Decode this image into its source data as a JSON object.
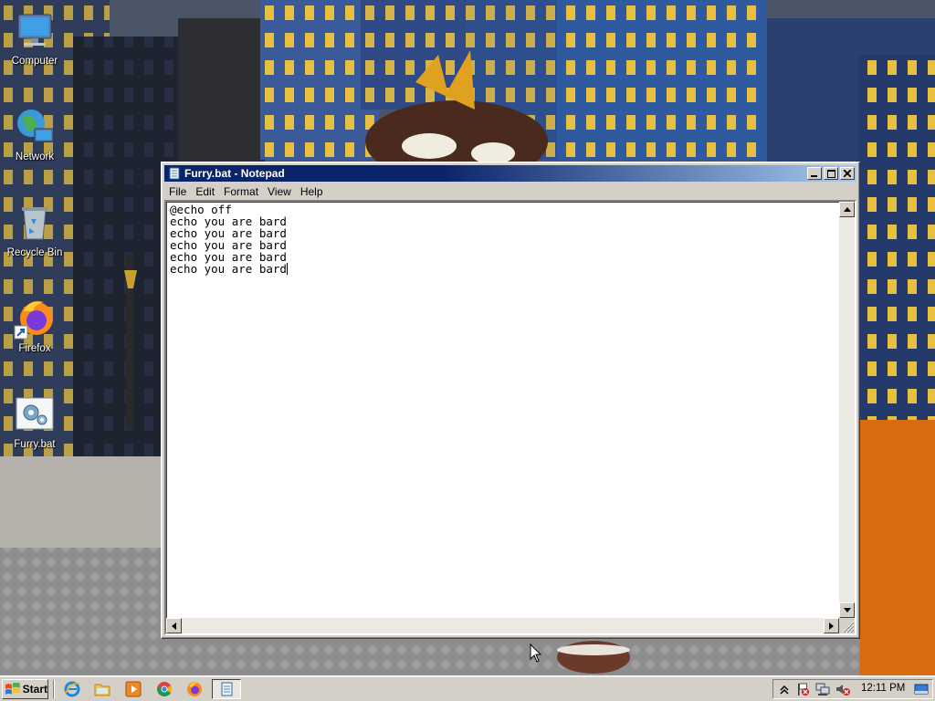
{
  "desktop": {
    "icons": [
      {
        "label": "Computer",
        "icon": "computer-icon"
      },
      {
        "label": "Network",
        "icon": "network-icon"
      },
      {
        "label": "Recycle Bin",
        "icon": "recycle-bin-icon"
      },
      {
        "label": "Firefox",
        "icon": "firefox-icon"
      },
      {
        "label": "Furry.bat",
        "icon": "batch-file-icon"
      }
    ]
  },
  "notepad": {
    "title": "Furry.bat - Notepad",
    "menu": [
      "File",
      "Edit",
      "Format",
      "View",
      "Help"
    ],
    "content": "@echo off\necho you are bard\necho you are bard\necho you are bard\necho you are bard\necho you are bard",
    "buttons": {
      "minimize": "minimize-icon",
      "maximize": "maximize-icon",
      "close": "close-icon"
    }
  },
  "taskbar": {
    "start_label": "Start",
    "quick_launch": [
      "internet-explorer-icon",
      "file-explorer-icon",
      "media-player-icon",
      "chrome-icon",
      "firefox-icon"
    ],
    "active_task": "notepad-icon",
    "tray_icons": [
      "show-hidden-icons-icon",
      "action-center-flag-icon",
      "network-status-icon",
      "volume-muted-icon"
    ],
    "clock": "12:11 PM",
    "show_desktop": "show-desktop-icon"
  },
  "colors": {
    "titlebar_start": "#0a246a",
    "titlebar_end": "#a6caf0",
    "window_face": "#d4d0c8"
  }
}
